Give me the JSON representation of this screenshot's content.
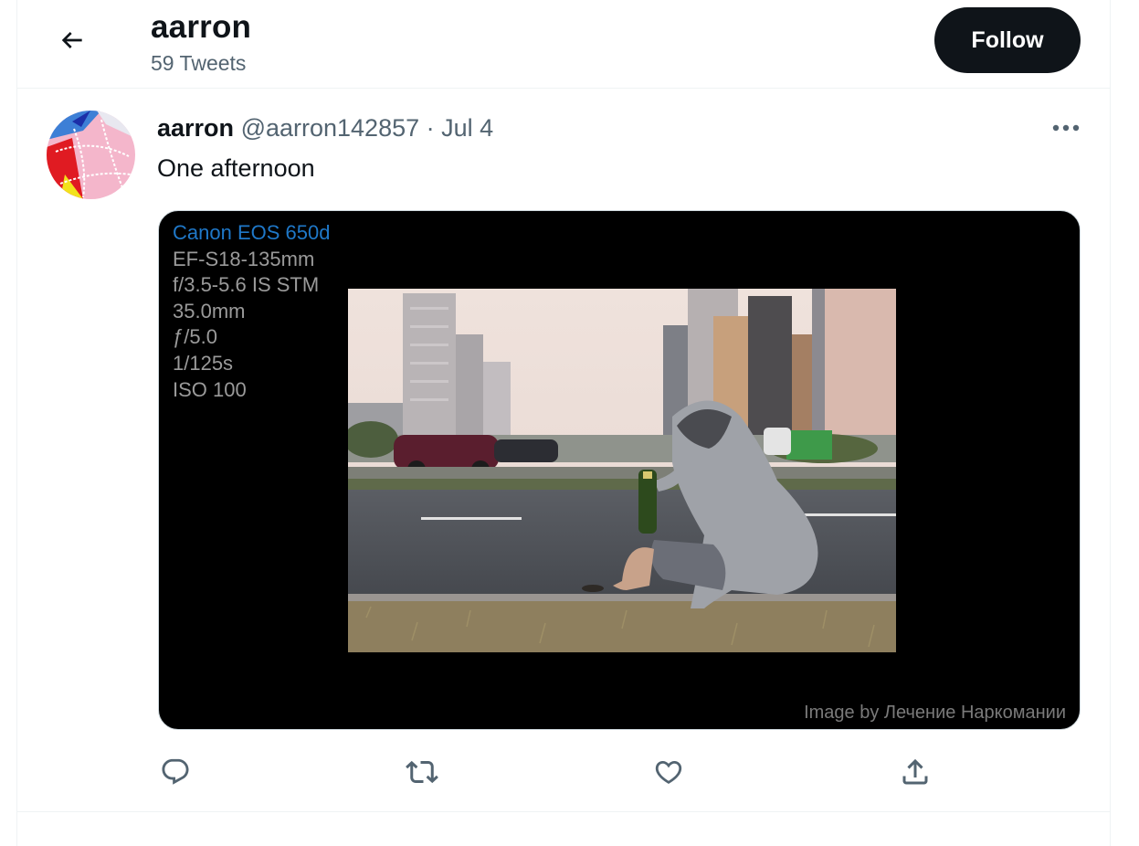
{
  "header": {
    "title": "aarron",
    "tweet_count": "59 Tweets",
    "follow_label": "Follow",
    "back_icon": "arrow-left-icon"
  },
  "tweet": {
    "author_name": "aarron",
    "author_handle": "@aarron142857",
    "separator": "·",
    "date": "Jul 4",
    "text": "One afternoon",
    "more_icon": "more-dots-icon",
    "media": {
      "camera_model": "Canon EOS 650d",
      "lens": "EF-S18-135mm",
      "lens_aperture": "f/3.5-5.6 IS STM",
      "focal_length": "35.0mm",
      "aperture": "ƒ/5.0",
      "shutter": "1/125s",
      "iso": "ISO 100",
      "credit": "Image by Лечение Наркомании"
    },
    "actions": {
      "reply_icon": "reply-icon",
      "retweet_icon": "retweet-icon",
      "like_icon": "heart-icon",
      "share_icon": "share-icon"
    }
  },
  "colors": {
    "text_primary": "#0f1419",
    "text_secondary": "#536471",
    "border": "#eff3f4",
    "camera_model_blue": "#1f78c8",
    "follow_bg": "#0f1419"
  }
}
